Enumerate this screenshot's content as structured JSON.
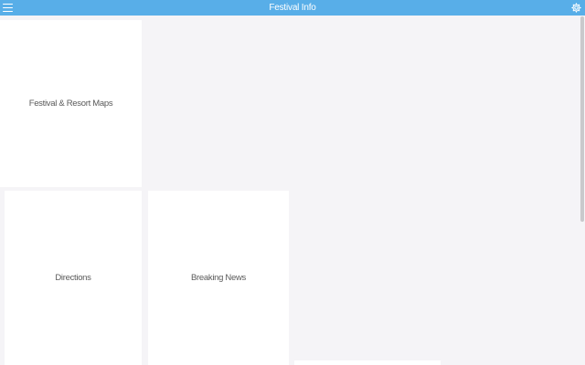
{
  "header": {
    "title": "Festival Info",
    "menu_icon": "hamburger-menu-icon",
    "settings_icon": "gear-icon",
    "color": "#58aee8"
  },
  "tiles": [
    {
      "label": "Festival & Resort Maps"
    },
    {
      "label": "Directions"
    },
    {
      "label": "Breaking News"
    }
  ],
  "colors": {
    "background": "#f5f4f7",
    "tile": "#ffffff",
    "tile_text": "#5a5a5a"
  }
}
